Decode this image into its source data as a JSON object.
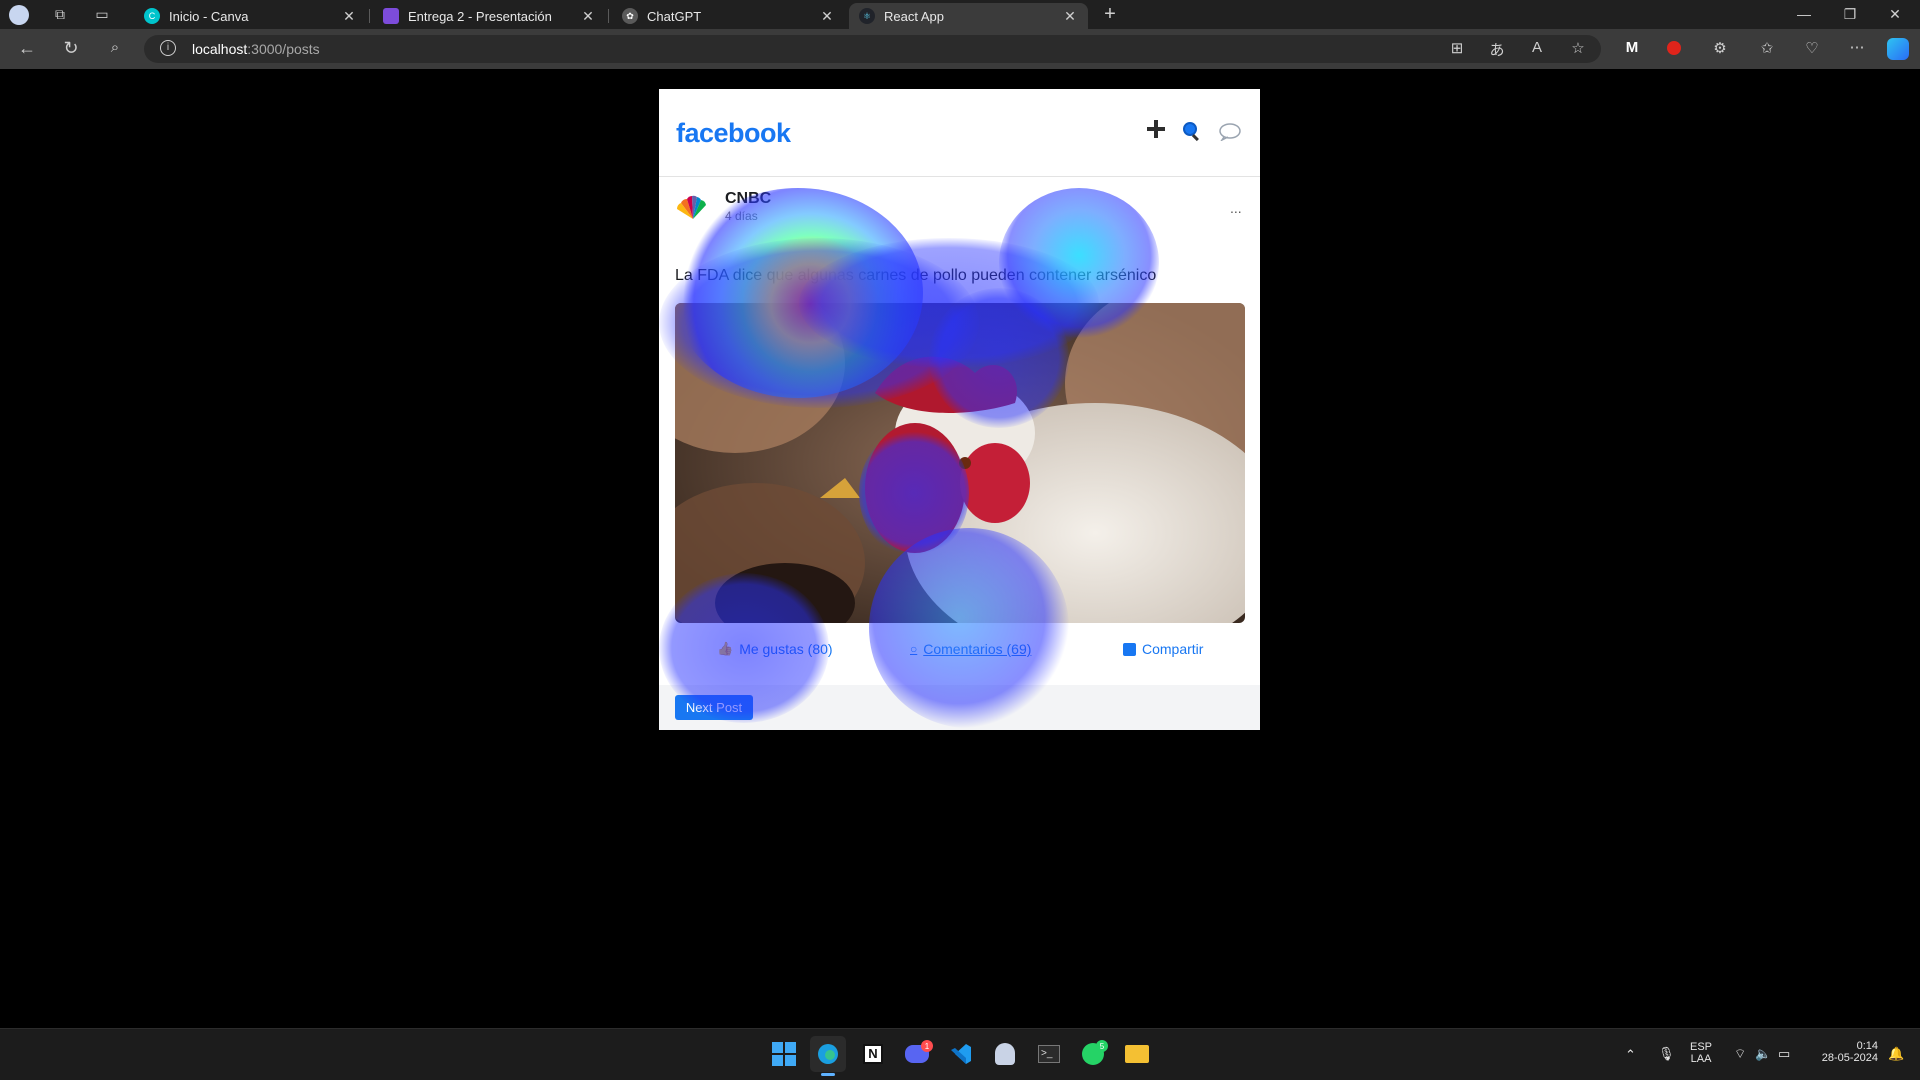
{
  "browser": {
    "tabs": [
      {
        "title": "Inicio - Canva",
        "favicon_color": "#00c4cc",
        "active": false
      },
      {
        "title": "Entrega 2 - Presentación",
        "favicon_color": "#7d4cdb",
        "active": false
      },
      {
        "title": "ChatGPT",
        "favicon_color": "#10a37f",
        "active": false
      },
      {
        "title": "React App",
        "favicon_color": "#61dafb",
        "active": true
      }
    ],
    "url_host": "localhost",
    "url_path": ":3000/posts",
    "new_tab_symbol": "+",
    "window_controls": [
      "—",
      "❐",
      "✕"
    ]
  },
  "app": {
    "logo": "facebook",
    "header_icons": [
      "plus-icon",
      "search-icon",
      "message-icon"
    ]
  },
  "post": {
    "author": "CNBC",
    "time": "4 días",
    "more": "...",
    "text": "La FDA dice que algunas carnes de pollo pueden contener arsénico",
    "image_subject": "chicken-photo",
    "actions": {
      "like": "Me gustas (80)",
      "comment": "Comentarios (69)",
      "share": "Compartir"
    },
    "next_button": "Next Post"
  },
  "overlay": {
    "type": "attention-heatmap",
    "colors": [
      "#ff2a1a",
      "#ffe81a",
      "#2aff9a",
      "#18d9ff",
      "#2a3cff"
    ]
  },
  "taskbar": {
    "apps": [
      "windows-start-icon",
      "edge-icon",
      "notion-icon",
      "discord-icon",
      "vscode-icon",
      "app-icon",
      "terminal-icon",
      "whatsapp-icon",
      "file-explorer-icon"
    ],
    "discord_badge": "1",
    "whatsapp_badge": "5",
    "lang_top": "ESP",
    "lang_bottom": "LAA",
    "time": "0:14",
    "date": "28-05-2024"
  }
}
